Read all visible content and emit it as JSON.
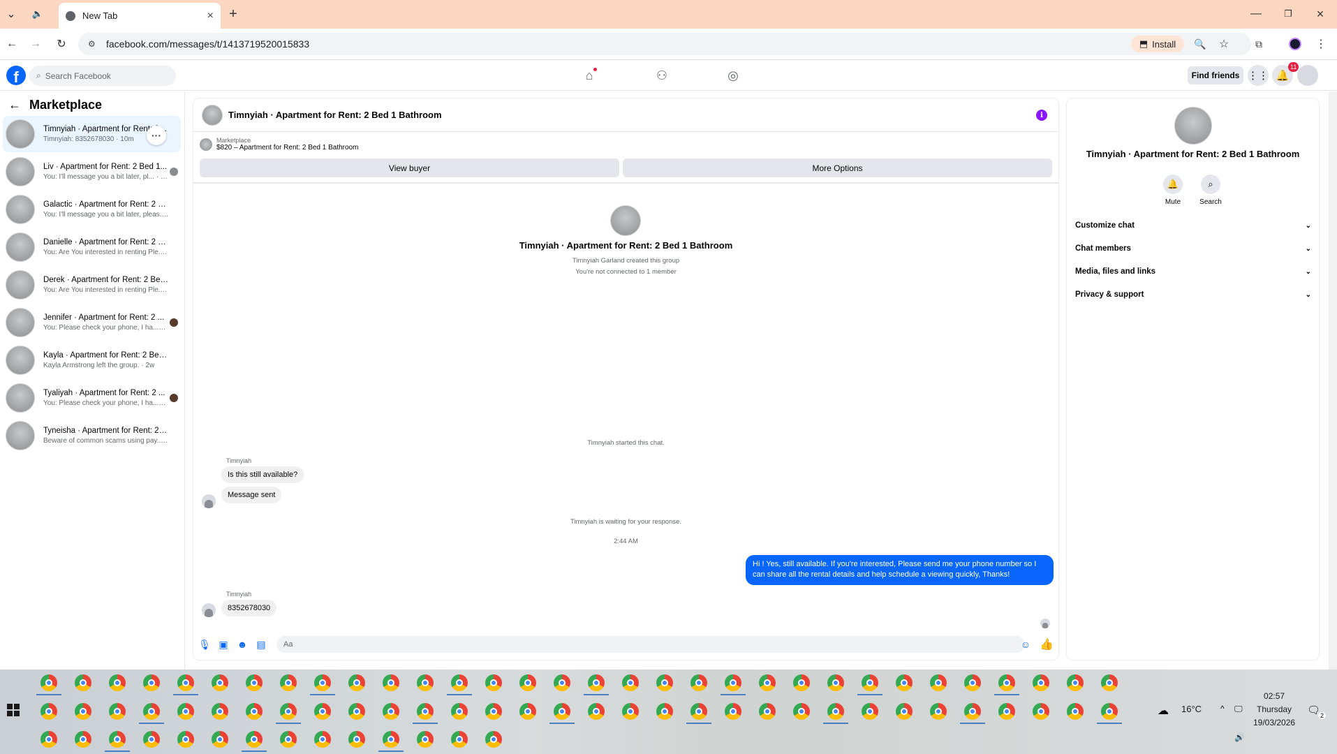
{
  "browser": {
    "tab_title": "New Tab",
    "url": "facebook.com/messages/t/1413719520015833",
    "install_label": "Install"
  },
  "fb_header": {
    "search_placeholder": "Search Facebook",
    "find_friends_label": "Find friends",
    "notification_count": "11"
  },
  "sidebar": {
    "title": "Marketplace",
    "conversations": [
      {
        "name": "Timnyiah · Apartment for Rent: 2 Bed 1 Bathroom",
        "preview": "Timnyiah: 8352678030 · 10m",
        "active": true
      },
      {
        "name": "Liv · Apartment for Rent: 2 Bed 1...",
        "preview": "You: I'll message you a bit later, pl...",
        "time": "· 2w"
      },
      {
        "name": "Galactic · Apartment for Rent: 2 Be...",
        "preview": "You: I'll message you a bit later, pleas...",
        "time": "· 2w"
      },
      {
        "name": "Danielle · Apartment for Rent: 2 B...",
        "preview": "You: Are You interested in renting Ple...",
        "time": "· 2w"
      },
      {
        "name": "Derek · Apartment for Rent: 2 Bed ...",
        "preview": "You: Are You interested in renting Ple...",
        "time": "· 2w"
      },
      {
        "name": "Jennifer · Apartment for Rent: 2 ...",
        "preview": "You: Please check your phone, I ha...",
        "time": "· 2w"
      },
      {
        "name": "Kayla · Apartment for Rent: 2 Bed ...",
        "preview": "Kayla Armstrong left the group.",
        "time": "· 2w"
      },
      {
        "name": "Tyaliyah · Apartment for Rent: 2 ...",
        "preview": "You: Please check your phone, I ha...",
        "time": "· 2w"
      },
      {
        "name": "Tyneisha · Apartment for Rent: 2 B...",
        "preview": "Beware of common scams using pay...",
        "time": "· 2w"
      }
    ]
  },
  "chat": {
    "header_title": "Timnyiah · Apartment for Rent: 2 Bed 1 Bathroom",
    "marketplace_label": "Marketplace",
    "listing": "$820 – Apartment for Rent: 2 Bed 1 Bathroom",
    "view_buyer_label": "View buyer",
    "more_options_label": "More Options",
    "group_title": "Timnyiah · Apartment for Rent: 2 Bed 1 Bathroom",
    "created_text": "Timnyiah Garland created this group",
    "connection_text": "You're not connected to 1 member",
    "started_text": "Timnyiah started this chat.",
    "sender1": "Timnyiah",
    "msg1": "Is this still available?",
    "msg2": "Message sent",
    "waiting_text": "Timnyiah is waiting for your response.",
    "timestamp": "2:44 AM",
    "out_msg": "Hi ! Yes, still available. If you're interested, Please send me your phone number so I can share all the rental details and help schedule a viewing quickly, Thanks!",
    "sender2": "Timnyiah",
    "msg3": "8352678030",
    "composer_placeholder": "Aa"
  },
  "info_panel": {
    "title": "Timnyiah · Apartment for Rent: 2 Bed 1 Bathroom",
    "mute_label": "Mute",
    "search_label": "Search",
    "rows": [
      "Customize chat",
      "Chat members",
      "Media, files and links",
      "Privacy & support"
    ]
  },
  "taskbar": {
    "temperature": "16°C",
    "time": "02:57",
    "day": "Thursday",
    "date": "19/03/2026",
    "notif_count": "2"
  },
  "colors": {
    "fb_blue": "#0866ff",
    "tabstrip": "#fbd7c1",
    "info_purple": "#8a16ff",
    "badge_red": "#e41e3f"
  }
}
